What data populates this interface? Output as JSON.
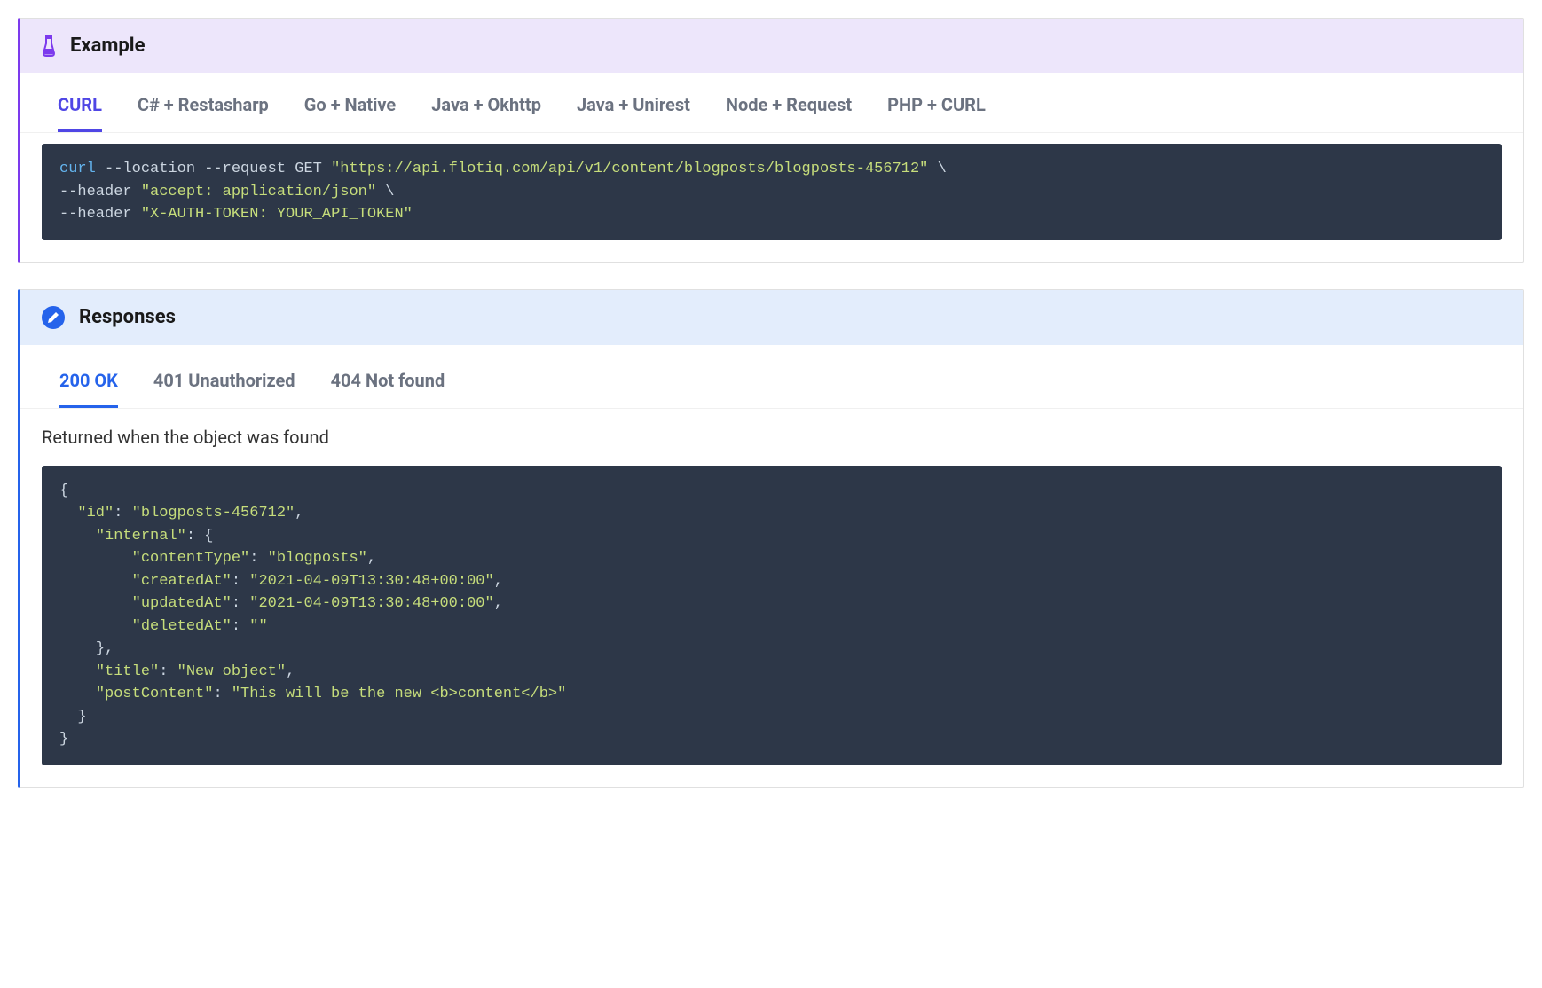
{
  "example": {
    "title": "Example",
    "tabs": [
      {
        "label": "CURL",
        "active": true
      },
      {
        "label": "C# + Restasharp",
        "active": false
      },
      {
        "label": "Go + Native",
        "active": false
      },
      {
        "label": "Java + Okhttp",
        "active": false
      },
      {
        "label": "Java + Unirest",
        "active": false
      },
      {
        "label": "Node + Request",
        "active": false
      },
      {
        "label": "PHP + CURL",
        "active": false
      }
    ],
    "code": {
      "cmd": "curl",
      "line1_flags": " --location --request GET ",
      "line1_url": "\"https://api.flotiq.com/api/v1/content/blogposts/blogposts-456712\"",
      "line1_cont": " \\",
      "line2_flag": "--header ",
      "line2_str": "\"accept: application/json\"",
      "line2_cont": " \\",
      "line3_flag": "--header ",
      "line3_str": "\"X-AUTH-TOKEN: YOUR_API_TOKEN\""
    }
  },
  "responses": {
    "title": "Responses",
    "tabs": [
      {
        "label": "200 OK",
        "active": true
      },
      {
        "label": "401 Unauthorized",
        "active": false
      },
      {
        "label": "404 Not found",
        "active": false
      }
    ],
    "description": "Returned when the object was found",
    "json": {
      "open": "{",
      "id_key": "\"id\"",
      "id_val": "\"blogposts-456712\"",
      "internal_key": "\"internal\"",
      "internal_open": "{",
      "contentType_key": "\"contentType\"",
      "contentType_val": "\"blogposts\"",
      "createdAt_key": "\"createdAt\"",
      "createdAt_val": "\"2021-04-09T13:30:48+00:00\"",
      "updatedAt_key": "\"updatedAt\"",
      "updatedAt_val": "\"2021-04-09T13:30:48+00:00\"",
      "deletedAt_key": "\"deletedAt\"",
      "deletedAt_val": "\"\"",
      "internal_close": "}",
      "title_key": "\"title\"",
      "title_val": "\"New object\"",
      "postContent_key": "\"postContent\"",
      "postContent_val": "\"This will be the new <b>content</b>\"",
      "body_close": "}",
      "close": "}"
    }
  }
}
